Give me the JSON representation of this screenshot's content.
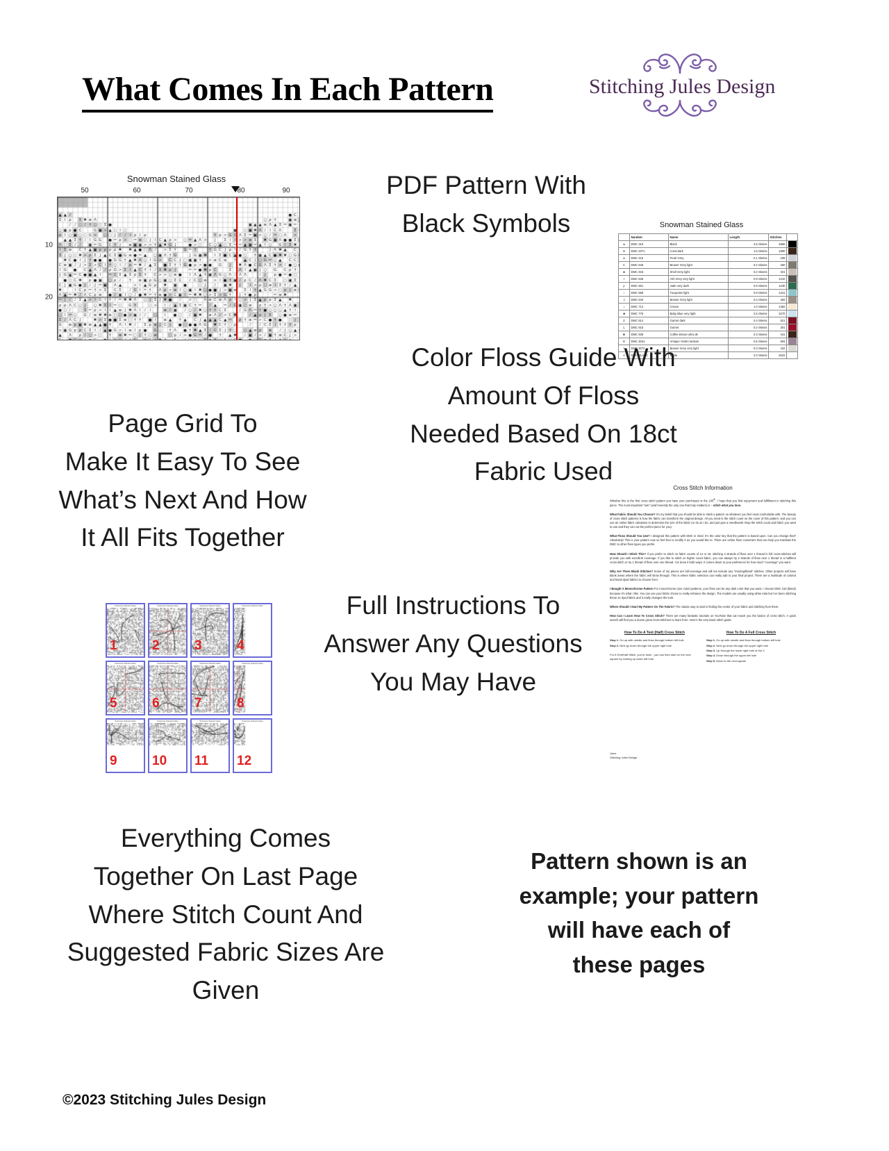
{
  "header": {
    "title": "What Comes In Each Pattern",
    "logo": {
      "name": "Stitching Jules Design",
      "accent_color": "#7b5ea7",
      "text_color": "#4c2a56"
    }
  },
  "callouts": {
    "pdf_pattern": "PDF Pattern With\nBlack Symbols",
    "page_grid": "Page Grid To\nMake It Easy To See\nWhat’s Next And How\nIt All Fits Together",
    "floss_guide": "Color Floss Guide With\nAmount Of Floss\nNeeded Based On 18ct\nFabric Used",
    "instructions": "Full Instructions To\nAnswer Any Questions\nYou May Have",
    "last_page": "Everything Comes\nTogether On Last Page\nWhere Stitch Count And\nSuggested Fabric Sizes Are\nGiven",
    "disclaimer": "Pattern shown is an\nexample; your pattern\nwill have each of\nthese pages"
  },
  "chart": {
    "title": "Snowman Stained Glass",
    "column_labels": [
      "50",
      "60",
      "70",
      "80",
      "90"
    ],
    "row_labels": [
      "10",
      "20"
    ],
    "center_line_color": "#e00000",
    "center_line_label": "center-marker"
  },
  "floss_table": {
    "title": "Snowman Stained Glass",
    "columns": [
      "",
      "Number",
      "Name",
      "Length",
      "Stitches",
      ""
    ],
    "rows": [
      {
        "symbol": "●",
        "number": "DMC   310",
        "name": "Black",
        "length": "3.5 Skeins",
        "stitches": "4886",
        "color": "#000000"
      },
      {
        "symbol": "m",
        "number": "DMC   3371",
        "name": "Coral dark",
        "length": "1.6 Skeins",
        "stitches": "1890",
        "color": "#3a2418"
      },
      {
        "symbol": "∆",
        "number": "DMC   415",
        "name": "Pearl Grey",
        "length": "0.1 Skeins",
        "stitches": "199",
        "color": "#cfd2d6"
      },
      {
        "symbol": "C",
        "number": "DMC   646",
        "name": "Beaver Grey light",
        "length": "0.2 Skeins",
        "stitches": "250",
        "color": "#7e7a72"
      },
      {
        "symbol": "♣",
        "number": "DMC   453",
        "name": "Shell Grey light",
        "length": "0.2 Skeins",
        "stitches": "321",
        "color": "#c9c0b8"
      },
      {
        "symbol": "I",
        "number": "DMC   535",
        "name": "Ash Grey very light",
        "length": "0.9 Skeins",
        "stitches": "1210",
        "color": "#54534f"
      },
      {
        "symbol": "ρ",
        "number": "DMC   561",
        "name": "Jade very dark",
        "length": "0.9 Skeins",
        "stitches": "1230",
        "color": "#2f6b4f"
      },
      {
        "symbol": "♀",
        "number": "DMC   598",
        "name": "Turquoise light",
        "length": "0.9 Skeins",
        "stitches": "1221",
        "color": "#8fc6cc"
      },
      {
        "symbol": "J",
        "number": "DMC   640",
        "name": "Beaver Grey light",
        "length": "0.4 Skeins",
        "stitches": "483",
        "color": "#9a9086"
      },
      {
        "symbol": "♪",
        "number": "DMC   712",
        "name": "Cream",
        "length": "1.0 Skeins",
        "stitches": "1382",
        "color": "#f3e9d4"
      },
      {
        "symbol": "■",
        "number": "DMC   775",
        "name": "Baby Blue very light",
        "length": "2.5 Skeins",
        "stitches": "3270",
        "color": "#cfe2ee"
      },
      {
        "symbol": "Σ",
        "number": "DMC   814",
        "name": "Garnet dark",
        "length": "0.4 Skeins",
        "stitches": "521",
        "color": "#7d0f22"
      },
      {
        "symbol": "L",
        "number": "DMC   816",
        "name": "Garnet",
        "length": "0.2 Skeins",
        "stitches": "301",
        "color": "#96122a"
      },
      {
        "symbol": "✖",
        "number": "DMC   938",
        "name": "Coffee Brown ultra dk",
        "length": "0.3 Skeins",
        "stitches": "441",
        "color": "#3b2418"
      },
      {
        "symbol": "D",
        "number": "DMC   3041",
        "name": "Antique Violet medium",
        "length": "0.5 Skeins",
        "stitches": "593",
        "color": "#9c8295"
      },
      {
        "symbol": ">",
        "number": "DMC   3072",
        "name": "Beaver Grey very light",
        "length": "0.3 Skeins",
        "stitches": "442",
        "color": "#dcdcd6"
      },
      {
        "symbol": "Λ",
        "number": "DMC   BLANC",
        "name": "White",
        "length": "2.0 Skeins",
        "stitches": "2622",
        "color": "#ffffff"
      }
    ]
  },
  "page_grid": {
    "thumb_title": "Snowman Stained Glass",
    "numbers": [
      "1",
      "2",
      "3",
      "4",
      "5",
      "6",
      "7",
      "8",
      "9",
      "10",
      "11",
      "12"
    ],
    "border_color": "#6a6ad8",
    "number_color": "#e02020"
  },
  "instructions_doc": {
    "title": "Cross Stitch Information",
    "paragraphs": [
      {
        "lead": "",
        "text": "Whether this is the first cross stitch pattern you have ever purchased or the 100<sup>th</sup>, I hope that you find enjoyment and fulfillment in stitching this piece. The most important “rule” (and honestly the only one that truly matters) is – <i>stitch what you love.</i>"
      },
      {
        "lead": "What Fabric Should You Choose?",
        "text": "It’s my belief that you should be able to stitch a pattern on whatever you feel most comfortable with. The beauty of cross stitch patterns is how the fabric can transform the original design. All you need is the stitch count on the cover of this pattern, and you can use an online fabric calculator to determine the size of the fabric (or do as I do, and just give a needlework shop the stitch count and fabric you want to use and they can cut the perfect piece for you)."
      },
      {
        "lead": "What Floss Should You Use?",
        "text": "I designed this pattern with DMC in mind. It’s the color key that the pattern is based upon. Can you change that? Absolutely! This is your pattern now so feel free to modify it as you would like to.  There are online floss converters that can help you translate the DMC to other floss types you prefer."
      },
      {
        "lead": "How Should I Stitch This?",
        "text": "If you prefer to stitch on fabric counts of 14 or 18, stitching 2 strands of floss over 1 thread in full cross-stitches will provide you with excellent coverage. If you like to stitch on higher count fabric, you can always try 2 strands of floss over 1 thread in a half/tent cross-stitch or try 1 thread of floss over one thread. I’ve done it both ways. It comes down to your preference for how much “coverage” you want."
      },
      {
        "lead": "Why Are There Blank Stitches?",
        "text": "Some of my pieces are full-coverage and will not include any “missing/blank” stitches. Other projects will have blank areas where the fabric will show through. This is where fabric selection can really add to your final project. There are a multitude of colored and hand-dyed fabrics to choose from."
      },
      {
        "lead": "I Bought A Monochrome Pattern",
        "text": "For monochrome (one color) patterns, your floss can be any dark color that you want. I choose DMC 310 (black) because it’s what I like. You can use your fabric choice to really enhance the design. The models are usually using white Aida but I’ve been stitching these on dyed fabric and it really changes the look."
      },
      {
        "lead": "Where Should I Start My Pattern On The Fabric?",
        "text": "The classic way to start is finding the center of your fabric and stitching from there."
      },
      {
        "lead": "How Can I Learn How To Cross Stitch?",
        "text": "There are many fantastic tutorials on YouTube that can teach you the basics of cross stitch. A quick search will find you a dozen great cross-stitchers to learn from. Here’s the very basic stitch guide."
      }
    ],
    "guide_left": {
      "heading": "How To Do A Tent (Half) Cross Stitch",
      "steps": [
        "<b>Step 1.</b> Go up with needle and floss through bottom left hole",
        "<b>Step 2.</b> Next go down through the upper right hole"
      ],
      "note": "For A Tent/Half Stitch, you’re done - you can then start on the next square by coming up lower left hole."
    },
    "guide_right": {
      "heading": "How To Do A Full Cross Stitch",
      "steps": [
        "<b>Step 1.</b> Go up with needle and floss through bottom left hole",
        "<b>Step 2.</b> Next go down through the upper right hole",
        "<b>Step 3.</b> Up through the lower right hole of the X",
        "<b>Step 4.</b> Down through the upper left hole",
        "<b>Step 5.</b> Move to the next square"
      ],
      "note": ""
    },
    "signature": "Jules\nStitching Jules Design"
  },
  "footer": {
    "copyright": "©2023 Stitching Jules Design"
  }
}
